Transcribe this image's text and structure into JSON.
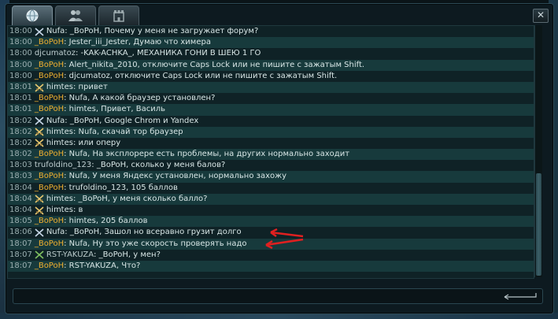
{
  "colors": {
    "time": "#9aaeb0",
    "bopoh": "#f0b030",
    "text": "#d8e6e6",
    "arrow": "#e02020"
  },
  "tabs": [
    {
      "icon": "globe-icon",
      "active": true
    },
    {
      "icon": "group-icon",
      "active": false
    },
    {
      "icon": "castle-icon",
      "active": false
    }
  ],
  "close_label": "✕",
  "messages": [
    {
      "time": "18:00",
      "icon": "swords-icon",
      "name": "Nufa",
      "text": ": _BoPoH, Почему у меня не загружает форум?",
      "cls": "name-admin"
    },
    {
      "time": "18:00",
      "icon": "",
      "name": "_BoPoH",
      "text": ": Jester_iii_Jester, Думаю что химера",
      "cls": "name-bop"
    },
    {
      "time": "18:00",
      "icon": "",
      "name": "djcumatoz",
      "text": ": -KAK-ACHKA_, МЕХАНИКА ГОНИ В ШЕЮ 1 ГО",
      "cls": "name-other"
    },
    {
      "time": "18:00",
      "icon": "",
      "name": "_BoPoH",
      "text": ": Alert_nikita_2010, отключите Caps Lock или не пишите с зажатым Shift.",
      "cls": "name-bop"
    },
    {
      "time": "18:00",
      "icon": "",
      "name": "_BoPoH",
      "text": ": djcumatoz, отключите Caps Lock или не пишите с зажатым Shift.",
      "cls": "name-bop"
    },
    {
      "time": "18:01",
      "icon": "cross-swords-icon",
      "name": "himtes",
      "text": ": привет",
      "cls": "name-admin"
    },
    {
      "time": "18:01",
      "icon": "",
      "name": "_BoPoH",
      "text": ": Nufa, А какой браузер установлен?",
      "cls": "name-bop"
    },
    {
      "time": "18:01",
      "icon": "",
      "name": "_BoPoH",
      "text": ": himtes, Привет, Василь",
      "cls": "name-bop"
    },
    {
      "time": "18:02",
      "icon": "swords-icon",
      "name": "Nufa",
      "text": ": _BoPoH, Google Chrom и Yandex",
      "cls": "name-admin"
    },
    {
      "time": "18:02",
      "icon": "cross-swords-icon",
      "name": "himtes",
      "text": ": Nufa, скачай тор браузер",
      "cls": "name-admin"
    },
    {
      "time": "18:02",
      "icon": "cross-swords-icon",
      "name": "himtes",
      "text": ": или оперу",
      "cls": "name-admin"
    },
    {
      "time": "18:02",
      "icon": "",
      "name": "_BoPoH",
      "text": ": Nufa, На эксплорере есть проблемы, на других нормально заходит",
      "cls": "name-bop"
    },
    {
      "time": "18:03",
      "icon": "",
      "name": "trufoldino_123",
      "text": ": _BoPoH, сколько у меня балов?",
      "cls": "name-other"
    },
    {
      "time": "18:03",
      "icon": "",
      "name": "_BoPoH",
      "text": ": Nufa, У меня Яндекс установлен, нормально захожу",
      "cls": "name-bop"
    },
    {
      "time": "18:04",
      "icon": "",
      "name": "_BoPoH",
      "text": ": trufoldino_123, 105 баллов",
      "cls": "name-bop"
    },
    {
      "time": "18:04",
      "icon": "cross-swords-icon",
      "name": "himtes",
      "text": ": _BoPoH, у меня сколько балло?",
      "cls": "name-admin"
    },
    {
      "time": "18:04",
      "icon": "cross-swords-icon",
      "name": "himtes",
      "text": ": в",
      "cls": "name-admin"
    },
    {
      "time": "18:05",
      "icon": "",
      "name": "_BoPoH",
      "text": ": himtes, 205 баллов",
      "cls": "name-bop"
    },
    {
      "time": "18:06",
      "icon": "swords-icon",
      "name": "Nufa",
      "text": ": _BoPoH, Зашол но всеравно грузит долго",
      "cls": "name-admin"
    },
    {
      "time": "18:07",
      "icon": "",
      "name": "_BoPoH",
      "text": ": Nufa, Ну это уже скорость проверять надо",
      "cls": "name-bop"
    },
    {
      "time": "18:07",
      "icon": "green-swords-icon",
      "name": "RST-YAKUZA",
      "text": ": _BoPoH, у мен?",
      "cls": "name-rst"
    },
    {
      "time": "18:07",
      "icon": "",
      "name": "_BoPoH",
      "text": ": RST-YAKUZA, Что?",
      "cls": "name-bop"
    }
  ],
  "send_icon": "enter-arrow-icon"
}
